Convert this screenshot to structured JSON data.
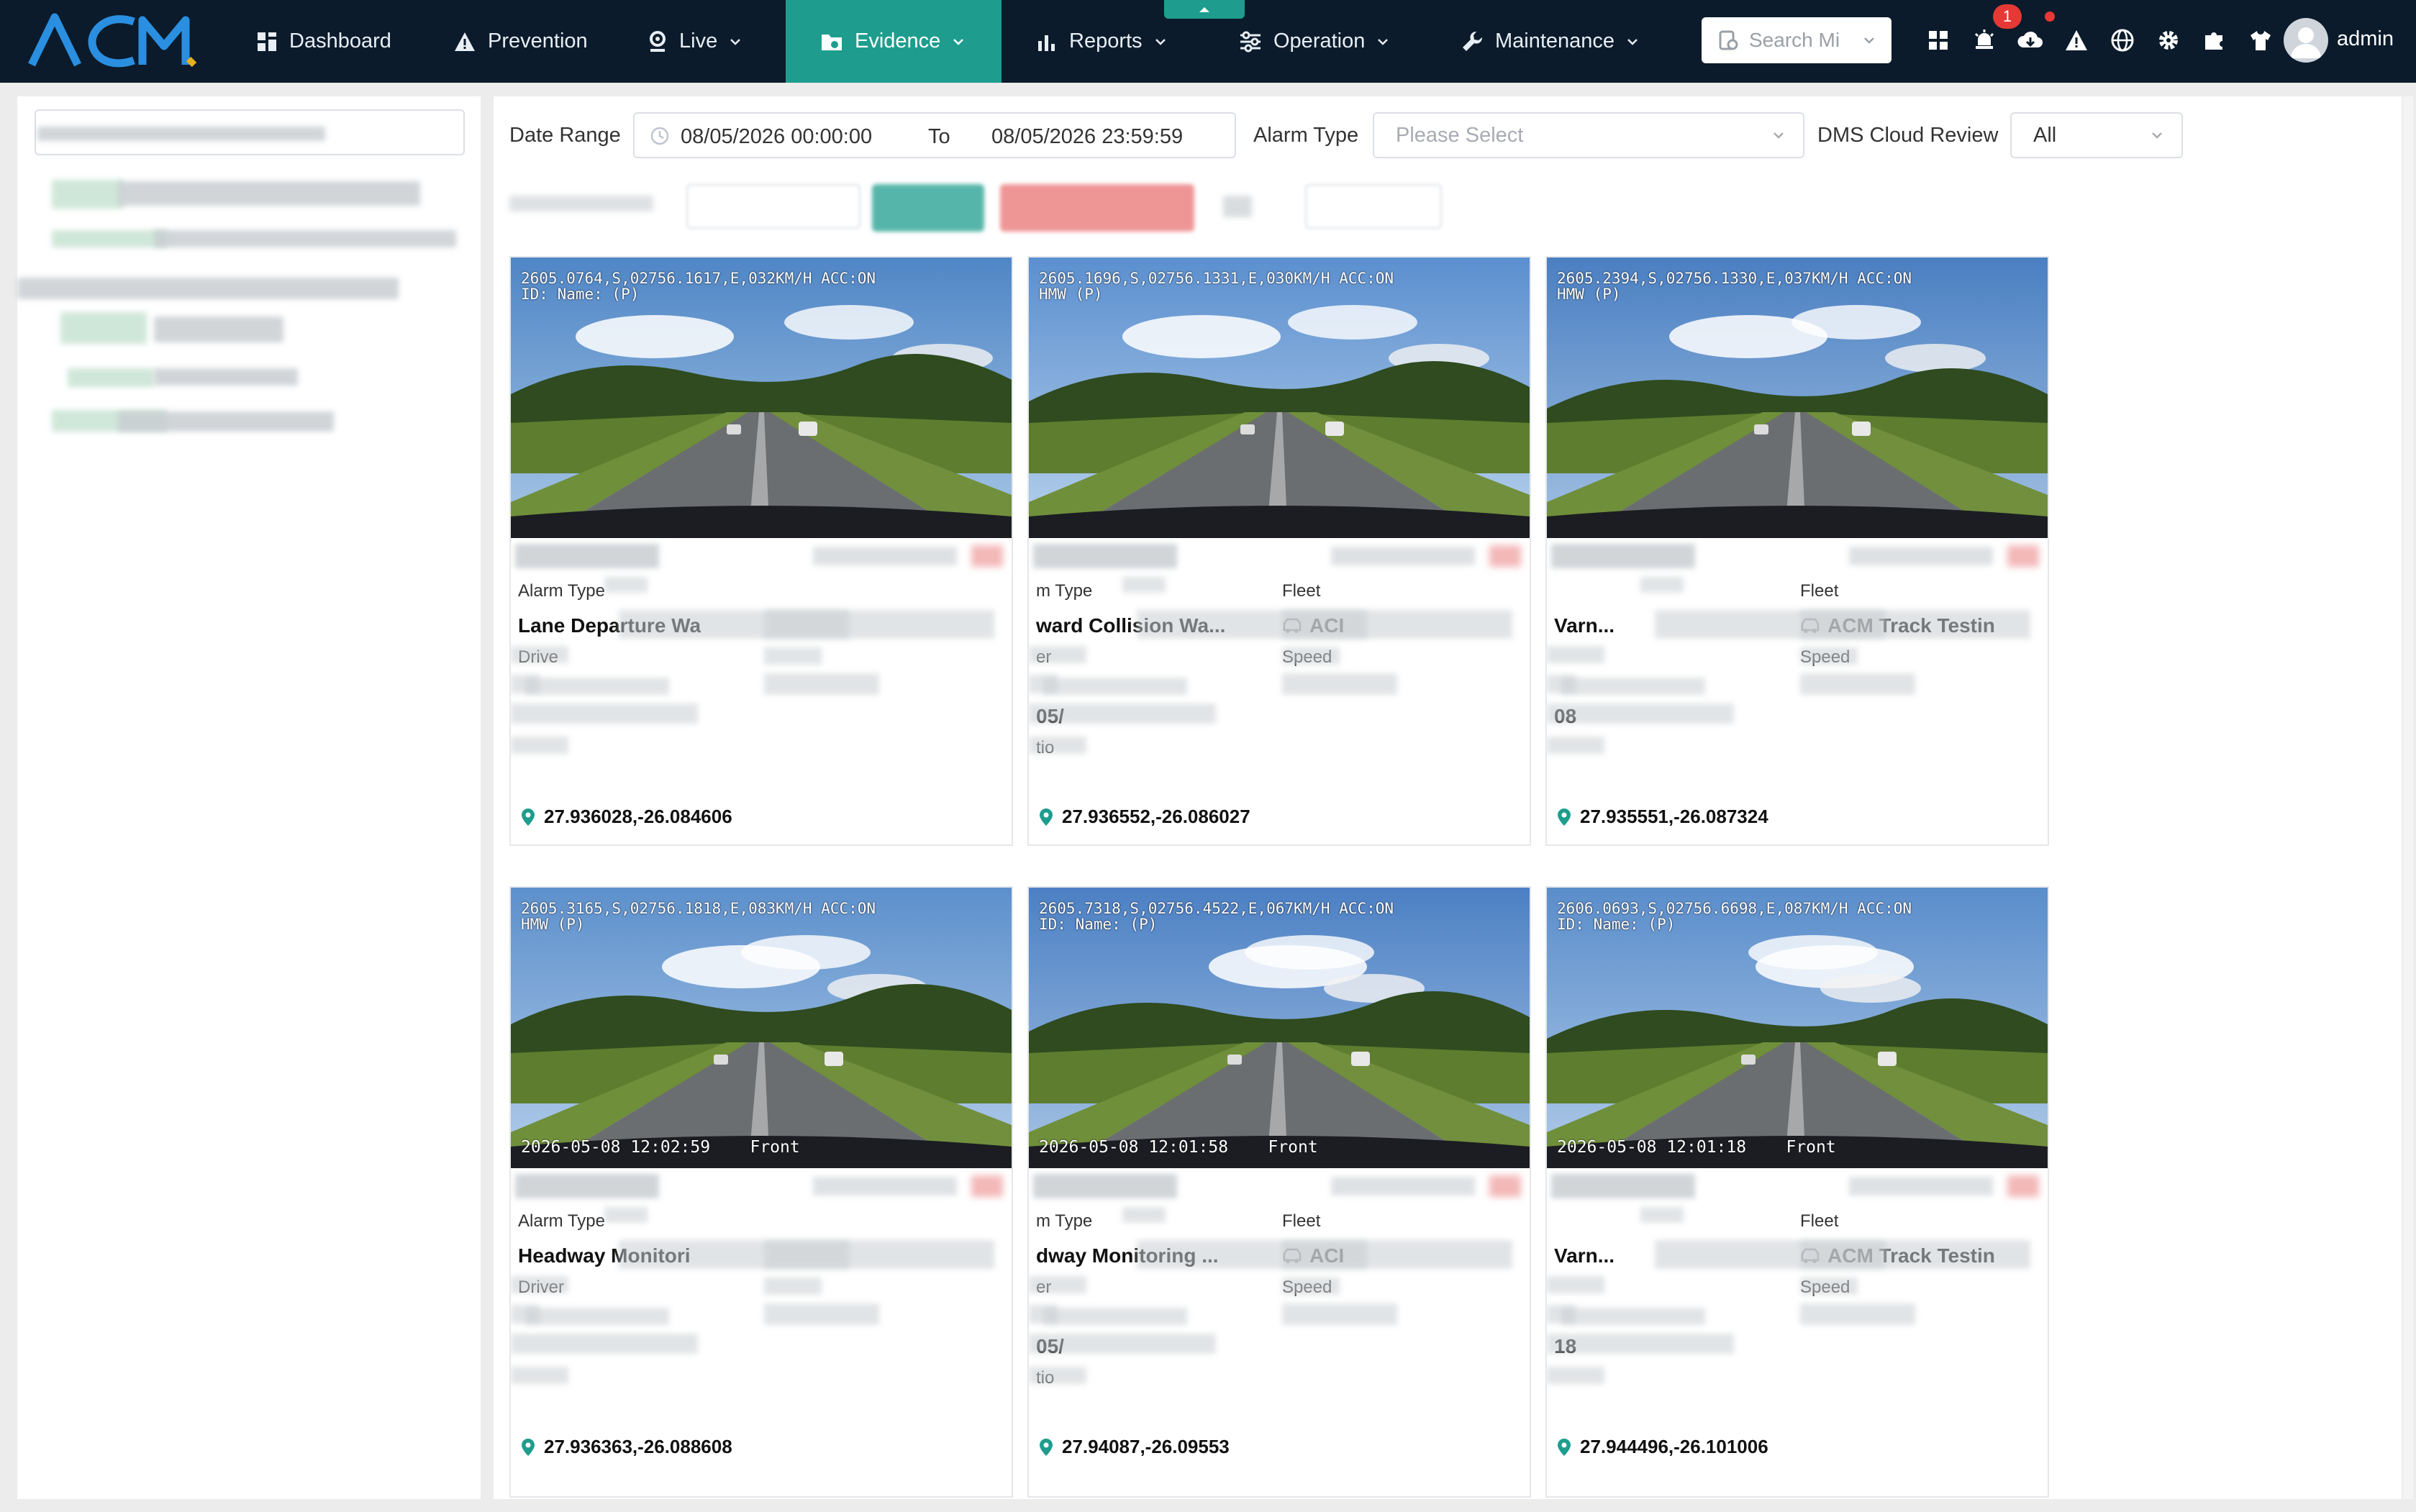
{
  "brand": {
    "logo_text": "ACM",
    "accent": "#1e9d8e",
    "nav_bg": "#0b1b2b"
  },
  "nav": {
    "items": [
      {
        "label": "Dashboard",
        "icon": "dashboard-icon"
      },
      {
        "label": "Prevention",
        "icon": "warning-icon"
      },
      {
        "label": "Live",
        "icon": "location-icon"
      },
      {
        "label": "Evidence",
        "icon": "folder-icon",
        "active": true
      },
      {
        "label": "Reports",
        "icon": "bar-chart-icon"
      },
      {
        "label": "Operation",
        "icon": "sliders-icon"
      },
      {
        "label": "Maintenance",
        "icon": "wrench-icon"
      }
    ],
    "search_placeholder": "Search Mi",
    "notification_count": "1",
    "user": "admin"
  },
  "filters": {
    "date_range_label": "Date Range",
    "date_from": "08/05/2026 00:00:00",
    "to_label": "To",
    "date_to": "08/05/2026 23:59:59",
    "alarm_type_label": "Alarm Type",
    "alarm_type_placeholder": "Please Select",
    "dms_label": "DMS Cloud Review",
    "dms_value": "All"
  },
  "cards": [
    {
      "osd_top": "2605.0764,S,02756.1617,E,032KM/H ACC:ON\nID: Name: (P)",
      "osd_bottom": "",
      "alarm_type_label": "Alarm Type",
      "alarm_type": "Lane Departure Wa",
      "fleet_label": "",
      "fleet": "",
      "driver_label": "Drive",
      "speed_label": "",
      "time_partial": "",
      "location_partial": "",
      "coords": "27.936028,-26.084606"
    },
    {
      "osd_top": "2605.1696,S,02756.1331,E,030KM/H ACC:ON\nHMW (P)",
      "osd_bottom": "",
      "alarm_type_label": "m Type",
      "alarm_type": "ward Collision Wa...",
      "fleet_label": "Fleet",
      "fleet": "ACI",
      "driver_label": "er",
      "speed_label": "Speed",
      "time_partial": "05/",
      "location_partial": "tio",
      "coords": "27.936552,-26.086027"
    },
    {
      "osd_top": "2605.2394,S,02756.1330,E,037KM/H ACC:ON\nHMW (P)",
      "osd_bottom": "",
      "alarm_type_label": "",
      "alarm_type": "Varn...",
      "fleet_label": "Fleet",
      "fleet": "ACM Track Testin",
      "driver_label": "",
      "speed_label": "Speed",
      "time_partial": "08",
      "location_partial": "",
      "coords": "27.935551,-26.087324"
    },
    {
      "osd_top": "2605.3165,S,02756.1818,E,083KM/H ACC:ON\nHMW (P)",
      "osd_bottom": "2026-05-08 12:02:59    Front",
      "alarm_type_label": "Alarm Type",
      "alarm_type": "Headway Monitori",
      "fleet_label": "",
      "fleet": "",
      "driver_label": "Driver",
      "speed_label": "",
      "time_partial": "",
      "location_partial": "",
      "coords": "27.936363,-26.088608"
    },
    {
      "osd_top": "2605.7318,S,02756.4522,E,067KM/H ACC:ON\nID: Name: (P)",
      "osd_bottom": "2026-05-08 12:01:58    Front",
      "alarm_type_label": "m Type",
      "alarm_type": "dway Monitoring ...",
      "fleet_label": "Fleet",
      "fleet": "ACI",
      "driver_label": "er",
      "speed_label": "Speed",
      "time_partial": "05/",
      "location_partial": "tio",
      "coords": "27.94087,-26.09553"
    },
    {
      "osd_top": "2606.0693,S,02756.6698,E,087KM/H ACC:ON\nID: Name: (P)",
      "osd_bottom": "2026-05-08 12:01:18    Front",
      "alarm_type_label": "",
      "alarm_type": "Varn...",
      "fleet_label": "Fleet",
      "fleet": "ACM Track Testin",
      "driver_label": "",
      "speed_label": "Speed",
      "time_partial": "18",
      "location_partial": "",
      "coords": "27.944496,-26.101006"
    }
  ]
}
